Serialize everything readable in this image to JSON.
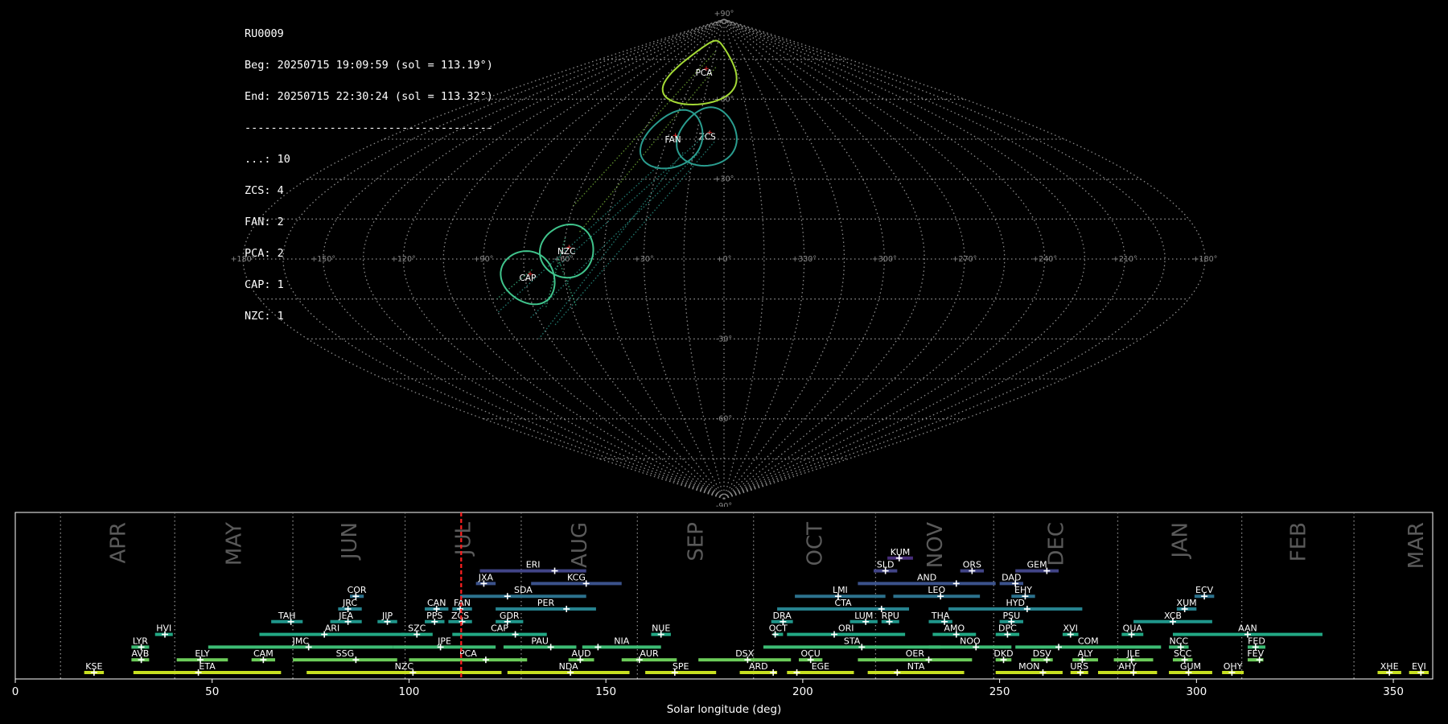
{
  "stats": {
    "lines": [
      "RU0009",
      "Beg: 20250715 19:09:59 (sol = 113.19°)",
      "End: 20250715 22:30:24 (sol = 113.32°)",
      "--------------------------------------",
      "...: 10",
      "ZCS: 4",
      "FAN: 2",
      "PCA: 2",
      "CAP: 1",
      "NZC: 1"
    ]
  },
  "skymap": {
    "projection": "sinusoidal",
    "lon_labels": [
      "+180°",
      "+150°",
      "+120°",
      "+90°",
      "+60°",
      "+30°",
      "+0°",
      "+330°",
      "+300°",
      "+270°",
      "+240°",
      "+210°",
      "+180°"
    ],
    "lat_labels": [
      "+90°",
      "+60°",
      "+30°",
      "-30°",
      "-60°",
      "-90°"
    ],
    "radiants": [
      {
        "code": "PCA",
        "lon": -22,
        "lat": 70,
        "radius": 12,
        "color": "#a5db36"
      },
      {
        "code": "ZCS",
        "lon": -9,
        "lat": 46,
        "radius": 11,
        "color": "#2a9d8f"
      },
      {
        "code": "FAN",
        "lon": -27,
        "lat": 45,
        "radius": 11,
        "color": "#2a9d8f"
      },
      {
        "code": "NZC",
        "lon": -59,
        "lat": 3,
        "radius": 10,
        "color": "#40c48c"
      },
      {
        "code": "CAP",
        "lon": -74,
        "lat": -7,
        "radius": 10,
        "color": "#40c48c"
      }
    ]
  },
  "timeline": {
    "xlabel": "Solar longitude (deg)",
    "xticks": [
      0,
      50,
      100,
      150,
      200,
      250,
      300,
      350
    ],
    "xlim": [
      0,
      360
    ],
    "current_sol": 113.25,
    "months": [
      {
        "label": "APR",
        "start": 11.5
      },
      {
        "label": "MAY",
        "start": 40.5
      },
      {
        "label": "JUN",
        "start": 70.5
      },
      {
        "label": "JUL",
        "start": 99
      },
      {
        "label": "AUG",
        "start": 128.5
      },
      {
        "label": "SEP",
        "start": 158
      },
      {
        "label": "OCT",
        "start": 187.5
      },
      {
        "label": "NOV",
        "start": 218.5
      },
      {
        "label": "DEC",
        "start": 248.5
      },
      {
        "label": "JAN",
        "start": 280
      },
      {
        "label": "FEB",
        "start": 311.5
      },
      {
        "label": "MAR",
        "start": 340
      }
    ],
    "showers": [
      {
        "code": "KSE",
        "start": 17.5,
        "end": 22.5,
        "peak": 20,
        "row": 0,
        "color": "#c7e020"
      },
      {
        "code": "ETA",
        "start": 30,
        "end": 67.5,
        "peak": 46.5,
        "row": 0,
        "color": "#c7e020"
      },
      {
        "code": "NZC",
        "start": 74,
        "end": 123.5,
        "peak": 101,
        "row": 0,
        "color": "#c7e020"
      },
      {
        "code": "NDA",
        "start": 125,
        "end": 156,
        "peak": 141,
        "row": 0,
        "color": "#c7e020"
      },
      {
        "code": "SPE",
        "start": 160,
        "end": 178,
        "peak": 167.5,
        "row": 0,
        "color": "#c7e020"
      },
      {
        "code": "ARD",
        "start": 184,
        "end": 193.5,
        "peak": 192.5,
        "row": 0,
        "color": "#c7e020"
      },
      {
        "code": "EGE",
        "start": 196,
        "end": 213,
        "peak": 198.5,
        "row": 0,
        "color": "#c7e020"
      },
      {
        "code": "NTA",
        "start": 216.5,
        "end": 241,
        "peak": 224,
        "row": 0,
        "color": "#c7e020"
      },
      {
        "code": "MON",
        "start": 249,
        "end": 266,
        "peak": 261,
        "row": 0,
        "color": "#c7e020"
      },
      {
        "code": "URS",
        "start": 268,
        "end": 272.5,
        "peak": 270.5,
        "row": 0,
        "color": "#c7e020"
      },
      {
        "code": "AHY",
        "start": 275,
        "end": 290,
        "peak": 284,
        "row": 0,
        "color": "#c7e020"
      },
      {
        "code": "GUM",
        "start": 293,
        "end": 304,
        "peak": 298,
        "row": 0,
        "color": "#c7e020"
      },
      {
        "code": "OHY",
        "start": 306.5,
        "end": 312,
        "peak": 309,
        "row": 0,
        "color": "#c7e020"
      },
      {
        "code": "XHE",
        "start": 346,
        "end": 352,
        "peak": 349,
        "row": 0,
        "color": "#c7e020"
      },
      {
        "code": "EVI",
        "start": 354,
        "end": 359,
        "peak": 357,
        "row": 0,
        "color": "#c7e020"
      },
      {
        "code": "AVB",
        "start": 29.5,
        "end": 34,
        "peak": 32,
        "row": 1,
        "color": "#6ccd5a"
      },
      {
        "code": "ELY",
        "start": 41,
        "end": 54,
        "peak": 47,
        "row": 1,
        "color": "#6ccd5a"
      },
      {
        "code": "CAM",
        "start": 60,
        "end": 66,
        "peak": 63,
        "row": 1,
        "color": "#6ccd5a"
      },
      {
        "code": "SSG",
        "start": 70.5,
        "end": 97,
        "peak": 86.5,
        "row": 1,
        "color": "#6ccd5a"
      },
      {
        "code": "PCA",
        "start": 100,
        "end": 130,
        "peak": 119.5,
        "row": 1,
        "color": "#6ccd5a"
      },
      {
        "code": "AUD",
        "start": 140.5,
        "end": 147,
        "peak": 143.5,
        "row": 1,
        "color": "#6ccd5a"
      },
      {
        "code": "AUR",
        "start": 154,
        "end": 168,
        "peak": 158.5,
        "row": 1,
        "color": "#6ccd5a"
      },
      {
        "code": "DSX",
        "start": 173.5,
        "end": 197,
        "peak": 186,
        "row": 1,
        "color": "#6ccd5a"
      },
      {
        "code": "OCU",
        "start": 199,
        "end": 205,
        "peak": 202,
        "row": 1,
        "color": "#6ccd5a"
      },
      {
        "code": "OER",
        "start": 214,
        "end": 243,
        "peak": 232,
        "row": 1,
        "color": "#6ccd5a"
      },
      {
        "code": "DKD",
        "start": 249,
        "end": 253,
        "peak": 251,
        "row": 1,
        "color": "#6ccd5a"
      },
      {
        "code": "DSV",
        "start": 258,
        "end": 263.5,
        "peak": 262,
        "row": 1,
        "color": "#6ccd5a"
      },
      {
        "code": "ALY",
        "start": 268.5,
        "end": 275,
        "peak": 271,
        "row": 1,
        "color": "#6ccd5a"
      },
      {
        "code": "JLE",
        "start": 279,
        "end": 289,
        "peak": 283.5,
        "row": 1,
        "color": "#6ccd5a"
      },
      {
        "code": "SCC",
        "start": 294,
        "end": 299,
        "peak": 297,
        "row": 1,
        "color": "#6ccd5a"
      },
      {
        "code": "FEV",
        "start": 313,
        "end": 317,
        "peak": 316,
        "row": 1,
        "color": "#6ccd5a"
      },
      {
        "code": "LYR",
        "start": 29.5,
        "end": 34,
        "peak": 32,
        "row": 2,
        "color": "#3dbc74"
      },
      {
        "code": "JMC",
        "start": 49,
        "end": 96,
        "peak": 74.5,
        "row": 2,
        "color": "#3dbc74"
      },
      {
        "code": "JPE",
        "start": 96,
        "end": 122,
        "peak": 108,
        "row": 2,
        "color": "#3dbc74"
      },
      {
        "code": "PAU",
        "start": 124,
        "end": 142.5,
        "peak": 136,
        "row": 2,
        "color": "#3dbc74"
      },
      {
        "code": "NIA",
        "start": 144,
        "end": 164,
        "peak": 148,
        "row": 2,
        "color": "#3dbc74"
      },
      {
        "code": "STA",
        "start": 190,
        "end": 235,
        "peak": 215,
        "row": 2,
        "color": "#3dbc74"
      },
      {
        "code": "NOO",
        "start": 232,
        "end": 253,
        "peak": 244,
        "row": 2,
        "color": "#3dbc74"
      },
      {
        "code": "COM",
        "start": 254,
        "end": 291,
        "peak": 265,
        "row": 2,
        "color": "#3dbc74"
      },
      {
        "code": "NCC",
        "start": 293,
        "end": 298,
        "peak": 296,
        "row": 2,
        "color": "#3dbc74"
      },
      {
        "code": "FED",
        "start": 313,
        "end": 317.5,
        "peak": 315,
        "row": 2,
        "color": "#3dbc74"
      },
      {
        "code": "HVI",
        "start": 35.5,
        "end": 40,
        "peak": 38,
        "row": 3,
        "color": "#22a884"
      },
      {
        "code": "ARI",
        "start": 62,
        "end": 99,
        "peak": 78.5,
        "row": 3,
        "color": "#22a884"
      },
      {
        "code": "SZC",
        "start": 98,
        "end": 106,
        "peak": 102,
        "row": 3,
        "color": "#22a884"
      },
      {
        "code": "CAP",
        "start": 111,
        "end": 135,
        "peak": 127,
        "row": 3,
        "color": "#22a884"
      },
      {
        "code": "NUE",
        "start": 161.5,
        "end": 166.5,
        "peak": 164,
        "row": 3,
        "color": "#22a884"
      },
      {
        "code": "OCT",
        "start": 192.5,
        "end": 195,
        "peak": 193,
        "row": 3,
        "color": "#22a884"
      },
      {
        "code": "ORI",
        "start": 196,
        "end": 226,
        "peak": 208,
        "row": 3,
        "color": "#22a884"
      },
      {
        "code": "AMO",
        "start": 233,
        "end": 244,
        "peak": 239,
        "row": 3,
        "color": "#22a884"
      },
      {
        "code": "DPC",
        "start": 249,
        "end": 255,
        "peak": 252,
        "row": 3,
        "color": "#22a884"
      },
      {
        "code": "XVI",
        "start": 266,
        "end": 270,
        "peak": 268,
        "row": 3,
        "color": "#22a884"
      },
      {
        "code": "QUA",
        "start": 281,
        "end": 286.5,
        "peak": 283.5,
        "row": 3,
        "color": "#22a884"
      },
      {
        "code": "AAN",
        "start": 294,
        "end": 332,
        "peak": 313,
        "row": 3,
        "color": "#22a884"
      },
      {
        "code": "TAH",
        "start": 65,
        "end": 73,
        "peak": 70,
        "row": 4,
        "color": "#1f968b"
      },
      {
        "code": "JEA",
        "start": 80,
        "end": 88,
        "peak": 84.5,
        "row": 4,
        "color": "#1f968b"
      },
      {
        "code": "JIP",
        "start": 92,
        "end": 97,
        "peak": 94.5,
        "row": 4,
        "color": "#1f968b"
      },
      {
        "code": "PPS",
        "start": 104,
        "end": 109,
        "peak": 106.5,
        "row": 4,
        "color": "#1f968b"
      },
      {
        "code": "ZCS",
        "start": 110,
        "end": 116,
        "peak": 113.5,
        "row": 4,
        "color": "#1f968b"
      },
      {
        "code": "GDR",
        "start": 122,
        "end": 129,
        "peak": 125,
        "row": 4,
        "color": "#1f968b"
      },
      {
        "code": "DRA",
        "start": 192,
        "end": 197.5,
        "peak": 195,
        "row": 4,
        "color": "#1f968b"
      },
      {
        "code": "LUM",
        "start": 212,
        "end": 219,
        "peak": 216,
        "row": 4,
        "color": "#1f968b"
      },
      {
        "code": "RPU",
        "start": 220,
        "end": 224.5,
        "peak": 222,
        "row": 4,
        "color": "#1f968b"
      },
      {
        "code": "THA",
        "start": 232,
        "end": 238,
        "peak": 236,
        "row": 4,
        "color": "#1f968b"
      },
      {
        "code": "PSU",
        "start": 250,
        "end": 256,
        "peak": 253,
        "row": 4,
        "color": "#1f968b"
      },
      {
        "code": "XCB",
        "start": 284,
        "end": 304,
        "peak": 294,
        "row": 4,
        "color": "#1f968b"
      },
      {
        "code": "JRC",
        "start": 82,
        "end": 88,
        "peak": 84.5,
        "row": 5,
        "color": "#26828e"
      },
      {
        "code": "CAN",
        "start": 104,
        "end": 110,
        "peak": 107,
        "row": 5,
        "color": "#26828e"
      },
      {
        "code": "FAN",
        "start": 111,
        "end": 116,
        "peak": 113,
        "row": 5,
        "color": "#26828e"
      },
      {
        "code": "PER",
        "start": 122,
        "end": 147.5,
        "peak": 140,
        "row": 5,
        "color": "#26828e"
      },
      {
        "code": "CTA",
        "start": 193.5,
        "end": 227,
        "peak": 220,
        "row": 5,
        "color": "#26828e"
      },
      {
        "code": "HYD",
        "start": 237,
        "end": 271,
        "peak": 257,
        "row": 5,
        "color": "#26828e"
      },
      {
        "code": "XUM",
        "start": 295,
        "end": 300,
        "peak": 297,
        "row": 5,
        "color": "#26828e"
      },
      {
        "code": "COR",
        "start": 85,
        "end": 88.5,
        "peak": 86.5,
        "row": 6,
        "color": "#2c728e"
      },
      {
        "code": "SDA",
        "start": 113,
        "end": 145,
        "peak": 125,
        "row": 6,
        "color": "#2c728e"
      },
      {
        "code": "LMI",
        "start": 198,
        "end": 221,
        "peak": 209,
        "row": 6,
        "color": "#2c728e"
      },
      {
        "code": "LEO",
        "start": 223,
        "end": 245,
        "peak": 235,
        "row": 6,
        "color": "#2c728e"
      },
      {
        "code": "EHY",
        "start": 253,
        "end": 259,
        "peak": 256.5,
        "row": 6,
        "color": "#2c728e"
      },
      {
        "code": "ECV",
        "start": 299.5,
        "end": 304.5,
        "peak": 302,
        "row": 6,
        "color": "#2c728e"
      },
      {
        "code": "JXA",
        "start": 117,
        "end": 122,
        "peak": 119,
        "row": 7,
        "color": "#3b528b"
      },
      {
        "code": "KCG",
        "start": 131,
        "end": 154,
        "peak": 145,
        "row": 7,
        "color": "#3b528b"
      },
      {
        "code": "AND",
        "start": 214,
        "end": 249,
        "peak": 239,
        "row": 7,
        "color": "#3b528b"
      },
      {
        "code": "DAD",
        "start": 250,
        "end": 256,
        "peak": 254,
        "row": 7,
        "color": "#3b528b"
      },
      {
        "code": "ERI",
        "start": 118,
        "end": 145,
        "peak": 137,
        "row": 8,
        "color": "#414487"
      },
      {
        "code": "SLD",
        "start": 218,
        "end": 224,
        "peak": 221,
        "row": 8,
        "color": "#414487"
      },
      {
        "code": "ORS",
        "start": 240,
        "end": 246,
        "peak": 243,
        "row": 8,
        "color": "#414487"
      },
      {
        "code": "GEM",
        "start": 254,
        "end": 265,
        "peak": 262,
        "row": 8,
        "color": "#414487"
      },
      {
        "code": "KUM",
        "start": 221.5,
        "end": 228,
        "peak": 224.5,
        "row": 9,
        "color": "#472d7b"
      }
    ]
  }
}
